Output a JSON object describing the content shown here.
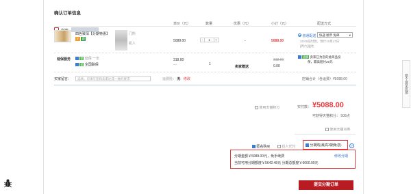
{
  "page": {
    "title": "确认订单信息"
  },
  "columns": [
    "单价（元）",
    "数量",
    "优惠（元）",
    "小计（元）",
    "配送方式"
  ],
  "shop": {
    "label": "店铺："
  },
  "product": {
    "name": "四色致深【分期特惠】",
    "name_suffix": "门所",
    "sub_label": "机人",
    "unit_price": "5088.00",
    "qty": "1",
    "discount": "-",
    "subtotal": "5088.00"
  },
  "shipping": {
    "option": "普通配送",
    "select_value": "快递 顺丰 免邮",
    "line1": "19:00前付款，预计10月17日",
    "line2": "[周六]送达",
    "note_tag": "退换",
    "note1": "卖家已为您的此商品投",
    "note2": "保，最高赔付25元"
  },
  "service": {
    "label": "延保服务",
    "item1": "延保 一年",
    "item2": "全国联保",
    "price": "318.00",
    "qty": "1",
    "seller": "卖家赠送",
    "price_strike": "318.00",
    "subtotal": "0.00"
  },
  "message": {
    "label": "买家留言：",
    "placeholder": "选填，可填写您和卖家达成一致的要求",
    "bundle_label": "运费险：",
    "bundle_value": "无",
    "bundle_link": "修改",
    "shop_total": "店铺合计（含运费）¥5088.00"
  },
  "totals": {
    "use_tmall_points": "使用天猫积分",
    "actual_label": "实付款：",
    "actual_value": "¥5088.00",
    "points_label": "可获得天猫积分：",
    "points_value": "508点",
    "use_tmall_coupon": "使用天猫点券"
  },
  "options": {
    "anonymous": "匿名购买",
    "others_pay": "找人代付",
    "installment": "分期购(最高3期免息)"
  },
  "installment_box": {
    "line1": "分期金额￥5088.00元，免手续费",
    "modify": "修改分期",
    "line2": "当前可用分期额度￥5642.48元 分期总额度￥6000.00元"
  },
  "submit": {
    "label": "提交分期订单"
  },
  "side": {
    "label": "给个意见反馈"
  },
  "colors": {
    "accent": "#e4393c",
    "submit_bg": "#b81c22",
    "link": "#3a7bd5"
  }
}
